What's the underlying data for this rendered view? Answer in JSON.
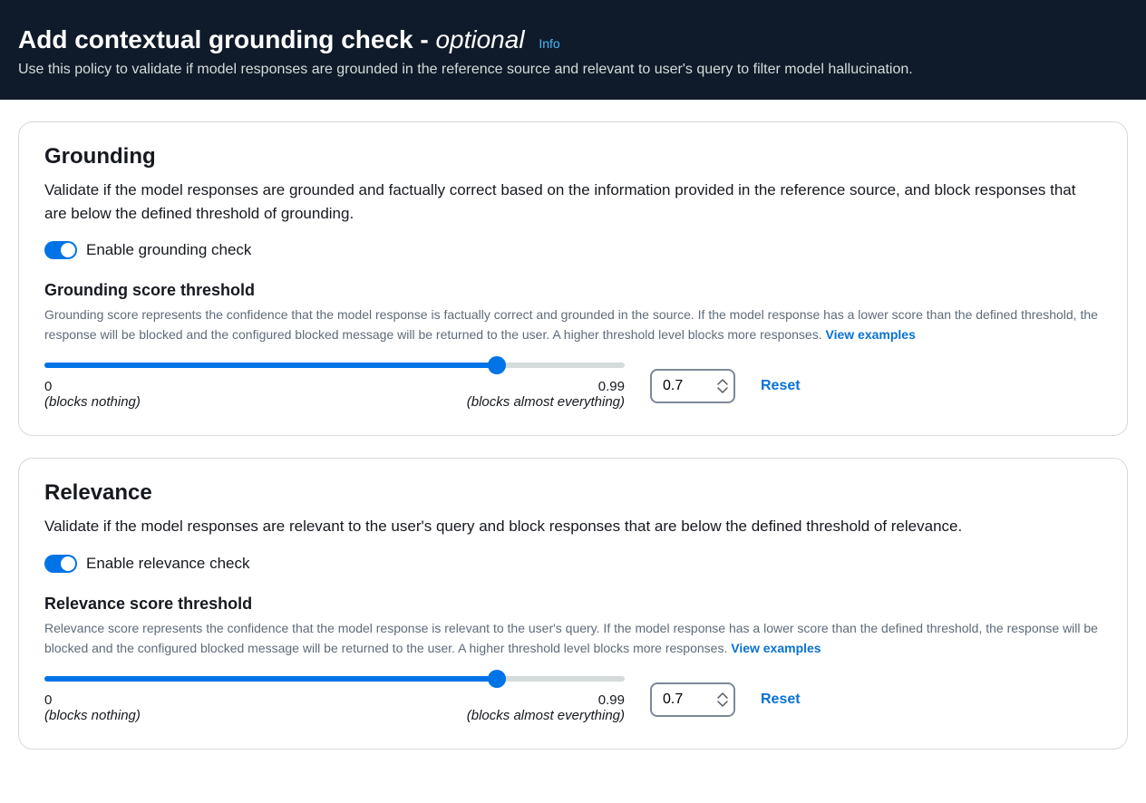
{
  "header": {
    "title_prefix": "Add contextual grounding check - ",
    "title_suffix": "optional",
    "info_label": "Info",
    "subtitle": "Use this policy to validate if model responses are grounded in the reference source and relevant to user's query to filter model hallucination."
  },
  "grounding": {
    "title": "Grounding",
    "desc": "Validate if the model responses are grounded and factually correct based on the information provided in the reference source, and block responses that are below the defined threshold of grounding.",
    "toggle_label": "Enable grounding check",
    "threshold_label": "Grounding score threshold",
    "threshold_desc": "Grounding score represents the confidence that the model response is factually correct and grounded in the source. If the model response has a lower score than the defined threshold, the response will be blocked and the configured blocked message will be returned to the user. A higher threshold level blocks more responses. ",
    "view_examples": "View examples",
    "value": "0.7",
    "slider": {
      "min_label": "0",
      "min_hint": "(blocks nothing)",
      "max_label": "0.99",
      "max_hint": "(blocks almost everything)",
      "fill_percent": 78
    },
    "reset_label": "Reset"
  },
  "relevance": {
    "title": "Relevance",
    "desc": "Validate if the model responses are relevant to the user's query and block responses that are below the defined threshold of relevance.",
    "toggle_label": "Enable relevance check",
    "threshold_label": "Relevance score threshold",
    "threshold_desc": "Relevance score represents the confidence that the model response is relevant to the user's query. If the model response has a lower score than the defined threshold, the response will be blocked and the configured blocked message will be returned to the user. A higher threshold level blocks more responses.  ",
    "view_examples": "View examples",
    "value": "0.7",
    "slider": {
      "min_label": "0",
      "min_hint": "(blocks nothing)",
      "max_label": "0.99",
      "max_hint": "(blocks almost everything)",
      "fill_percent": 78
    },
    "reset_label": "Reset"
  }
}
